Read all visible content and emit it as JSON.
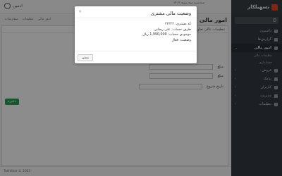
{
  "app": {
    "banner_text": "سه‌شنبه سه شنبه ۱۴۰۲",
    "brand": "تسهیلکار",
    "user_name": "ادمین",
    "page_title": "امور مالی",
    "breadcrumb": [
      "امور مالی",
      "تنظیمات",
      "سفارشات"
    ]
  },
  "sidebar": {
    "items": [
      {
        "label": "داشبورد"
      },
      {
        "label": "گزارش‌ها"
      },
      {
        "label": "امور مالی"
      },
      {
        "label": "تنظیمات مالی"
      },
      {
        "label": "حسابداری"
      },
      {
        "label": "فروش"
      },
      {
        "label": "پیامک"
      },
      {
        "label": "کاربران"
      },
      {
        "label": "مدیریت"
      },
      {
        "label": "تنظیمات"
      }
    ]
  },
  "form": {
    "panel_header": "تنظیمات عالی تعاون",
    "field_labels": [
      "مبلغ",
      "مبلغ",
      "تاریخ شروع"
    ],
    "save_button": "ذخیره"
  },
  "footer": {
    "text": "Tashilkar © 2023"
  },
  "modal": {
    "title": "وضعیت مالی مشتری",
    "lines": [
      "کد مشتری: ۲۲۳۲۳",
      "طرف حساب: علی رضایی",
      "موجودی حساب: 1,990,000 ریال",
      "وضعیت: فعال"
    ],
    "close_button": "بستن",
    "close_icon": "×"
  }
}
